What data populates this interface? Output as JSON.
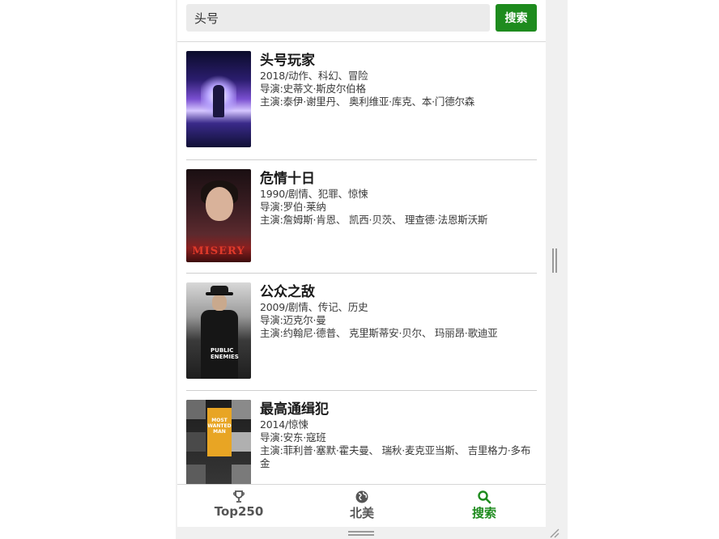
{
  "search": {
    "value": "头号",
    "button_label": "搜索"
  },
  "movies": [
    {
      "title": "头号玩家",
      "meta": "2018/动作、科幻、冒险",
      "director": "导演:史蒂文·斯皮尔伯格",
      "cast": "主演:泰伊·谢里丹、 奥利维亚·库克、本·门德尔森"
    },
    {
      "title": "危情十日",
      "meta": "1990/剧情、犯罪、惊悚",
      "director": "导演:罗伯·莱纳",
      "cast": "主演:詹姆斯·肯恩、 凯西·贝茨、 理查德·法恩斯沃斯",
      "poster_text": "MISERY"
    },
    {
      "title": "公众之敌",
      "meta": "2009/剧情、传记、历史",
      "director": "导演:迈克尔·曼",
      "cast": "主演:约翰尼·德普、 克里斯蒂安·贝尔、 玛丽昂·歌迪亚",
      "poster_text": "PUBLIC ENEMIES"
    },
    {
      "title": "最高通缉犯",
      "meta": "2014/惊悚",
      "director": "导演:安东·寇班",
      "cast": "主演:菲利普·塞默·霍夫曼、 瑞秋·麦克亚当斯、 吉里格力·多布金",
      "poster_text": "MOST WANTED MAN"
    }
  ],
  "tabs": [
    {
      "label": "Top250",
      "icon": "trophy-icon"
    },
    {
      "label": "北美",
      "icon": "globe-icon"
    },
    {
      "label": "搜索",
      "icon": "search-icon",
      "active": true
    }
  ],
  "colors": {
    "accent": "#1e8b1e",
    "tab_inactive": "#555555",
    "search_bg": "#ebebeb"
  }
}
